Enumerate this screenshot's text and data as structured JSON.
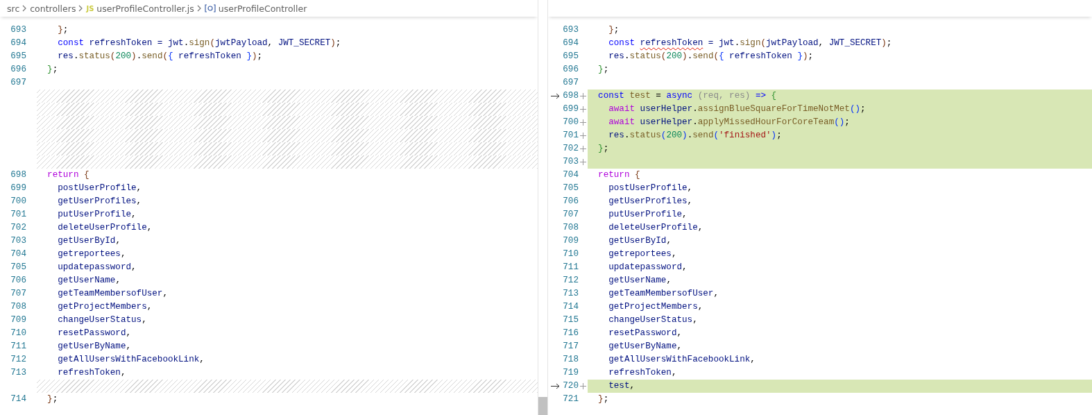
{
  "breadcrumb": [
    {
      "kind": "text",
      "label": "src"
    },
    {
      "kind": "text",
      "label": "controllers"
    },
    {
      "kind": "file",
      "badge": "JS",
      "label": "userProfileController.js"
    },
    {
      "kind": "symbol",
      "label": "userProfileController"
    }
  ],
  "left": [
    {
      "kind": "line",
      "number": "693",
      "tokens": [
        {
          "text": "    }",
          "kind": "b3"
        },
        {
          "text": ";",
          "kind": "p"
        }
      ]
    },
    {
      "kind": "line",
      "number": "694",
      "tokens": [
        {
          "text": "    const",
          "kind": "kw"
        },
        {
          "text": " refreshToken = jwt",
          "kind": "var"
        },
        {
          "text": ".",
          "kind": "p"
        },
        {
          "text": "sign",
          "kind": "fn"
        },
        {
          "text": "(",
          "kind": "b3"
        },
        {
          "text": "jwtPayload",
          "kind": "var"
        },
        {
          "text": ", ",
          "kind": "p"
        },
        {
          "text": "JWT_SECRET",
          "kind": "var"
        },
        {
          "text": ")",
          "kind": "b3"
        },
        {
          "text": ";",
          "kind": "p"
        }
      ]
    },
    {
      "kind": "line",
      "number": "695",
      "tokens": [
        {
          "text": "    res",
          "kind": "var"
        },
        {
          "text": ".",
          "kind": "p"
        },
        {
          "text": "status",
          "kind": "fn"
        },
        {
          "text": "(",
          "kind": "b3"
        },
        {
          "text": "200",
          "kind": "num"
        },
        {
          "text": ")",
          "kind": "b3"
        },
        {
          "text": ".",
          "kind": "p"
        },
        {
          "text": "send",
          "kind": "fn"
        },
        {
          "text": "(",
          "kind": "b3"
        },
        {
          "text": "{",
          "kind": "b1"
        },
        {
          "text": " refreshToken ",
          "kind": "var"
        },
        {
          "text": "}",
          "kind": "b1"
        },
        {
          "text": ")",
          "kind": "b3"
        },
        {
          "text": ";",
          "kind": "p"
        }
      ]
    },
    {
      "kind": "line",
      "number": "696",
      "tokens": [
        {
          "text": "  }",
          "kind": "b2"
        },
        {
          "text": ";",
          "kind": "p"
        }
      ]
    },
    {
      "kind": "line",
      "number": "697"
    },
    {
      "kind": "filler"
    },
    {
      "kind": "filler"
    },
    {
      "kind": "filler"
    },
    {
      "kind": "filler"
    },
    {
      "kind": "filler"
    },
    {
      "kind": "filler"
    },
    {
      "kind": "line",
      "number": "698",
      "tokens": [
        {
          "text": "  return",
          "kind": "ctl"
        },
        {
          "text": " {",
          "kind": "b3"
        }
      ]
    },
    {
      "kind": "line",
      "number": "699",
      "tokens": [
        {
          "text": "    postUserProfile",
          "kind": "var"
        },
        {
          "text": ",",
          "kind": "p"
        }
      ]
    },
    {
      "kind": "line",
      "number": "700",
      "tokens": [
        {
          "text": "    getUserProfiles",
          "kind": "var"
        },
        {
          "text": ",",
          "kind": "p"
        }
      ]
    },
    {
      "kind": "line",
      "number": "701",
      "tokens": [
        {
          "text": "    putUserProfile",
          "kind": "var"
        },
        {
          "text": ",",
          "kind": "p"
        }
      ]
    },
    {
      "kind": "line",
      "number": "702",
      "tokens": [
        {
          "text": "    deleteUserProfile",
          "kind": "var"
        },
        {
          "text": ",",
          "kind": "p"
        }
      ]
    },
    {
      "kind": "line",
      "number": "703",
      "tokens": [
        {
          "text": "    getUserById",
          "kind": "var"
        },
        {
          "text": ",",
          "kind": "p"
        }
      ]
    },
    {
      "kind": "line",
      "number": "704",
      "tokens": [
        {
          "text": "    getreportees",
          "kind": "var"
        },
        {
          "text": ",",
          "kind": "p"
        }
      ]
    },
    {
      "kind": "line",
      "number": "705",
      "tokens": [
        {
          "text": "    updatepassword",
          "kind": "var"
        },
        {
          "text": ",",
          "kind": "p"
        }
      ]
    },
    {
      "kind": "line",
      "number": "706",
      "tokens": [
        {
          "text": "    getUserName",
          "kind": "var"
        },
        {
          "text": ",",
          "kind": "p"
        }
      ]
    },
    {
      "kind": "line",
      "number": "707",
      "tokens": [
        {
          "text": "    getTeamMembersofUser",
          "kind": "var"
        },
        {
          "text": ",",
          "kind": "p"
        }
      ]
    },
    {
      "kind": "line",
      "number": "708",
      "tokens": [
        {
          "text": "    getProjectMembers",
          "kind": "var"
        },
        {
          "text": ",",
          "kind": "p"
        }
      ]
    },
    {
      "kind": "line",
      "number": "709",
      "tokens": [
        {
          "text": "    changeUserStatus",
          "kind": "var"
        },
        {
          "text": ",",
          "kind": "p"
        }
      ]
    },
    {
      "kind": "line",
      "number": "710",
      "tokens": [
        {
          "text": "    resetPassword",
          "kind": "var"
        },
        {
          "text": ",",
          "kind": "p"
        }
      ]
    },
    {
      "kind": "line",
      "number": "711",
      "tokens": [
        {
          "text": "    getUserByName",
          "kind": "var"
        },
        {
          "text": ",",
          "kind": "p"
        }
      ]
    },
    {
      "kind": "line",
      "number": "712",
      "tokens": [
        {
          "text": "    getAllUsersWithFacebookLink",
          "kind": "var"
        },
        {
          "text": ",",
          "kind": "p"
        }
      ]
    },
    {
      "kind": "line",
      "number": "713",
      "tokens": [
        {
          "text": "    refreshToken",
          "kind": "var"
        },
        {
          "text": ",",
          "kind": "p"
        }
      ]
    },
    {
      "kind": "filler"
    },
    {
      "kind": "line",
      "number": "714",
      "tokens": [
        {
          "text": "  }",
          "kind": "b3"
        },
        {
          "text": ";",
          "kind": "p"
        }
      ]
    }
  ],
  "right": [
    {
      "kind": "line",
      "number": "693",
      "added": false,
      "arrow": false,
      "tokens": [
        {
          "text": "    }",
          "kind": "b3"
        },
        {
          "text": ";",
          "kind": "p"
        }
      ]
    },
    {
      "kind": "line",
      "number": "694",
      "added": false,
      "arrow": false,
      "tokens": [
        {
          "text": "    const ",
          "kind": "kw"
        },
        {
          "text": "refreshToken",
          "kind": "var",
          "squiggly": true
        },
        {
          "text": " = jwt",
          "kind": "var"
        },
        {
          "text": ".",
          "kind": "p"
        },
        {
          "text": "sign",
          "kind": "fn"
        },
        {
          "text": "(",
          "kind": "b3"
        },
        {
          "text": "jwtPayload",
          "kind": "var"
        },
        {
          "text": ", ",
          "kind": "p"
        },
        {
          "text": "JWT_SECRET",
          "kind": "var"
        },
        {
          "text": ")",
          "kind": "b3"
        },
        {
          "text": ";",
          "kind": "p"
        }
      ]
    },
    {
      "kind": "line",
      "number": "695",
      "added": false,
      "arrow": false,
      "tokens": [
        {
          "text": "    res",
          "kind": "var"
        },
        {
          "text": ".",
          "kind": "p"
        },
        {
          "text": "status",
          "kind": "fn"
        },
        {
          "text": "(",
          "kind": "b3"
        },
        {
          "text": "200",
          "kind": "num"
        },
        {
          "text": ")",
          "kind": "b3"
        },
        {
          "text": ".",
          "kind": "p"
        },
        {
          "text": "send",
          "kind": "fn"
        },
        {
          "text": "(",
          "kind": "b3"
        },
        {
          "text": "{",
          "kind": "b1"
        },
        {
          "text": " refreshToken ",
          "kind": "var"
        },
        {
          "text": "}",
          "kind": "b1"
        },
        {
          "text": ")",
          "kind": "b3"
        },
        {
          "text": ";",
          "kind": "p"
        }
      ]
    },
    {
      "kind": "line",
      "number": "696",
      "added": false,
      "arrow": false,
      "tokens": [
        {
          "text": "  }",
          "kind": "b2"
        },
        {
          "text": ";",
          "kind": "p"
        }
      ]
    },
    {
      "kind": "line",
      "number": "697",
      "added": false,
      "arrow": false
    },
    {
      "kind": "line",
      "number": "698",
      "added": true,
      "arrow": true,
      "tokens": [
        {
          "text": "  const ",
          "kind": "kw"
        },
        {
          "text": "test",
          "kind": "fn"
        },
        {
          "text": " = ",
          "kind": "p"
        },
        {
          "text": "async",
          "kind": "kw"
        },
        {
          "text": " (req, res) ",
          "kind": "param"
        },
        {
          "text": "=>",
          "kind": "kw"
        },
        {
          "text": " {",
          "kind": "b2"
        }
      ]
    },
    {
      "kind": "line",
      "number": "699",
      "added": true,
      "arrow": false,
      "tokens": [
        {
          "text": "    await",
          "kind": "ctl"
        },
        {
          "text": " userHelper",
          "kind": "var"
        },
        {
          "text": ".",
          "kind": "p"
        },
        {
          "text": "assignBlueSquareForTimeNotMet",
          "kind": "fn"
        },
        {
          "text": "()",
          "kind": "b1"
        },
        {
          "text": ";",
          "kind": "p"
        }
      ]
    },
    {
      "kind": "line",
      "number": "700",
      "added": true,
      "arrow": false,
      "tokens": [
        {
          "text": "    await",
          "kind": "ctl"
        },
        {
          "text": " userHelper",
          "kind": "var"
        },
        {
          "text": ".",
          "kind": "p"
        },
        {
          "text": "applyMissedHourForCoreTeam",
          "kind": "fn"
        },
        {
          "text": "()",
          "kind": "b1"
        },
        {
          "text": ";",
          "kind": "p"
        }
      ]
    },
    {
      "kind": "line",
      "number": "701",
      "added": true,
      "arrow": false,
      "tokens": [
        {
          "text": "    res",
          "kind": "var"
        },
        {
          "text": ".",
          "kind": "p"
        },
        {
          "text": "status",
          "kind": "fn"
        },
        {
          "text": "(",
          "kind": "b1"
        },
        {
          "text": "200",
          "kind": "num"
        },
        {
          "text": ")",
          "kind": "b1"
        },
        {
          "text": ".",
          "kind": "p"
        },
        {
          "text": "send",
          "kind": "fn"
        },
        {
          "text": "(",
          "kind": "b1"
        },
        {
          "text": "'finished'",
          "kind": "str"
        },
        {
          "text": ")",
          "kind": "b1"
        },
        {
          "text": ";",
          "kind": "p"
        }
      ]
    },
    {
      "kind": "line",
      "number": "702",
      "added": true,
      "arrow": false,
      "tokens": [
        {
          "text": "  }",
          "kind": "b2"
        },
        {
          "text": ";",
          "kind": "p"
        }
      ]
    },
    {
      "kind": "line",
      "number": "703",
      "added": true,
      "arrow": false
    },
    {
      "kind": "line",
      "number": "704",
      "added": false,
      "arrow": false,
      "tokens": [
        {
          "text": "  return",
          "kind": "ctl"
        },
        {
          "text": " {",
          "kind": "b3"
        }
      ]
    },
    {
      "kind": "line",
      "number": "705",
      "added": false,
      "arrow": false,
      "tokens": [
        {
          "text": "    postUserProfile",
          "kind": "var"
        },
        {
          "text": ",",
          "kind": "p"
        }
      ]
    },
    {
      "kind": "line",
      "number": "706",
      "added": false,
      "arrow": false,
      "tokens": [
        {
          "text": "    getUserProfiles",
          "kind": "var"
        },
        {
          "text": ",",
          "kind": "p"
        }
      ]
    },
    {
      "kind": "line",
      "number": "707",
      "added": false,
      "arrow": false,
      "tokens": [
        {
          "text": "    putUserProfile",
          "kind": "var"
        },
        {
          "text": ",",
          "kind": "p"
        }
      ]
    },
    {
      "kind": "line",
      "number": "708",
      "added": false,
      "arrow": false,
      "tokens": [
        {
          "text": "    deleteUserProfile",
          "kind": "var"
        },
        {
          "text": ",",
          "kind": "p"
        }
      ]
    },
    {
      "kind": "line",
      "number": "709",
      "added": false,
      "arrow": false,
      "tokens": [
        {
          "text": "    getUserById",
          "kind": "var"
        },
        {
          "text": ",",
          "kind": "p"
        }
      ]
    },
    {
      "kind": "line",
      "number": "710",
      "added": false,
      "arrow": false,
      "tokens": [
        {
          "text": "    getreportees",
          "kind": "var"
        },
        {
          "text": ",",
          "kind": "p"
        }
      ]
    },
    {
      "kind": "line",
      "number": "711",
      "added": false,
      "arrow": false,
      "tokens": [
        {
          "text": "    updatepassword",
          "kind": "var"
        },
        {
          "text": ",",
          "kind": "p"
        }
      ]
    },
    {
      "kind": "line",
      "number": "712",
      "added": false,
      "arrow": false,
      "tokens": [
        {
          "text": "    getUserName",
          "kind": "var"
        },
        {
          "text": ",",
          "kind": "p"
        }
      ]
    },
    {
      "kind": "line",
      "number": "713",
      "added": false,
      "arrow": false,
      "tokens": [
        {
          "text": "    getTeamMembersofUser",
          "kind": "var"
        },
        {
          "text": ",",
          "kind": "p"
        }
      ]
    },
    {
      "kind": "line",
      "number": "714",
      "added": false,
      "arrow": false,
      "tokens": [
        {
          "text": "    getProjectMembers",
          "kind": "var"
        },
        {
          "text": ",",
          "kind": "p"
        }
      ]
    },
    {
      "kind": "line",
      "number": "715",
      "added": false,
      "arrow": false,
      "tokens": [
        {
          "text": "    changeUserStatus",
          "kind": "var"
        },
        {
          "text": ",",
          "kind": "p"
        }
      ]
    },
    {
      "kind": "line",
      "number": "716",
      "added": false,
      "arrow": false,
      "tokens": [
        {
          "text": "    resetPassword",
          "kind": "var"
        },
        {
          "text": ",",
          "kind": "p"
        }
      ]
    },
    {
      "kind": "line",
      "number": "717",
      "added": false,
      "arrow": false,
      "tokens": [
        {
          "text": "    getUserByName",
          "kind": "var"
        },
        {
          "text": ",",
          "kind": "p"
        }
      ]
    },
    {
      "kind": "line",
      "number": "718",
      "added": false,
      "arrow": false,
      "tokens": [
        {
          "text": "    getAllUsersWithFacebookLink",
          "kind": "var"
        },
        {
          "text": ",",
          "kind": "p"
        }
      ]
    },
    {
      "kind": "line",
      "number": "719",
      "added": false,
      "arrow": false,
      "tokens": [
        {
          "text": "    refreshToken",
          "kind": "var"
        },
        {
          "text": ",",
          "kind": "p"
        }
      ]
    },
    {
      "kind": "line",
      "number": "720",
      "added": true,
      "arrow": true,
      "tokens": [
        {
          "text": "    test",
          "kind": "var"
        },
        {
          "text": ",",
          "kind": "p"
        }
      ]
    },
    {
      "kind": "line",
      "number": "721",
      "added": false,
      "arrow": false,
      "tokens": [
        {
          "text": "  }",
          "kind": "b3"
        },
        {
          "text": ";",
          "kind": "p"
        }
      ]
    }
  ]
}
